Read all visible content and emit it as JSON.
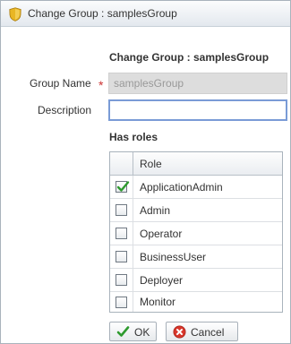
{
  "window": {
    "title": "Change Group : samplesGroup",
    "title_icon": "shield-icon"
  },
  "form": {
    "heading": "Change Group : samplesGroup",
    "group_name_label": "Group Name",
    "required_marker": "*",
    "group_name_value": "samplesGroup",
    "description_label": "Description",
    "description_value": ""
  },
  "roles": {
    "heading": "Has roles",
    "column_header": "Role",
    "items": [
      {
        "label": "ApplicationAdmin",
        "checked": true
      },
      {
        "label": "Admin",
        "checked": false
      },
      {
        "label": "Operator",
        "checked": false
      },
      {
        "label": "BusinessUser",
        "checked": false
      },
      {
        "label": "Deployer",
        "checked": false
      },
      {
        "label": "Monitor",
        "checked": false
      }
    ]
  },
  "buttons": {
    "ok_label": "OK",
    "ok_icon": "checkmark-icon",
    "cancel_label": "Cancel",
    "cancel_icon": "cancel-icon"
  },
  "colors": {
    "check_green": "#2e9a2e",
    "required_red": "#cc3333",
    "cancel_red": "#d9372c",
    "focus_border": "#7a9bd6"
  }
}
